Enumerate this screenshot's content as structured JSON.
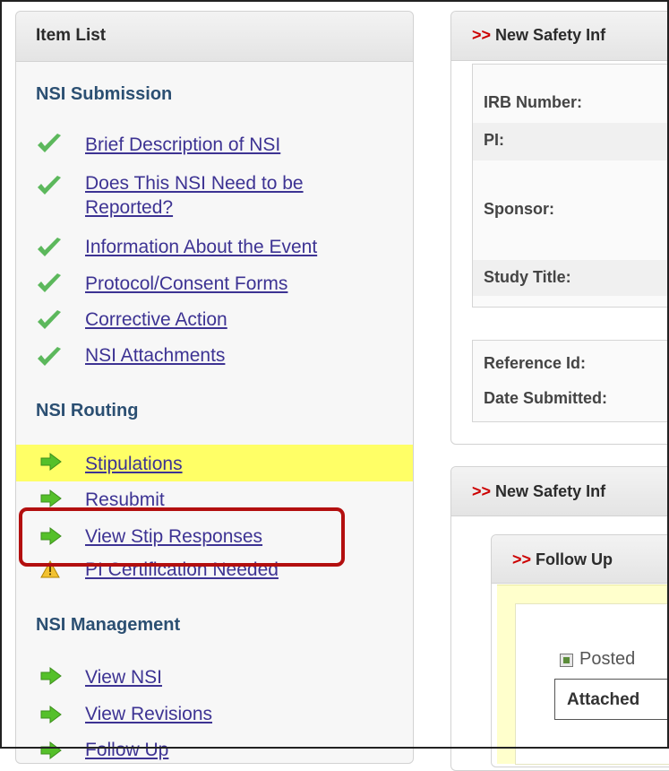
{
  "item_list": {
    "title": "Item List",
    "sections": [
      {
        "title": "NSI Submission",
        "items": [
          {
            "label": "Brief Description of NSI",
            "icon": "check-icon"
          },
          {
            "label": "Does This NSI Need to be Reported?",
            "icon": "check-icon"
          },
          {
            "label": "Information About the Event",
            "icon": "check-icon"
          },
          {
            "label": "Protocol/Consent Forms",
            "icon": "check-icon"
          },
          {
            "label": "Corrective Action",
            "icon": "check-icon"
          },
          {
            "label": "NSI Attachments",
            "icon": "check-icon"
          }
        ]
      },
      {
        "title": "NSI Routing",
        "items": [
          {
            "label": "Stipulations",
            "icon": "arrow-right-icon",
            "highlighted": true
          },
          {
            "label": "Resubmit",
            "icon": "arrow-right-icon"
          },
          {
            "label": "View Stip Responses",
            "icon": "arrow-right-icon",
            "callout": true
          },
          {
            "label": "PI Certification Needed",
            "icon": "warning-icon"
          }
        ]
      },
      {
        "title": "NSI Management",
        "items": [
          {
            "label": "View NSI",
            "icon": "arrow-right-icon"
          },
          {
            "label": "View Revisions",
            "icon": "arrow-right-icon"
          },
          {
            "label": "Follow Up",
            "icon": "arrow-right-icon"
          }
        ]
      }
    ]
  },
  "info_panel": {
    "prefix": ">>",
    "title": "New Safety Inf",
    "fields": [
      "IRB Number:",
      "PI:",
      "Sponsor:",
      "Study Title:"
    ],
    "ref_fields": [
      "Reference Id:",
      "Date Submitted:"
    ]
  },
  "second_panel": {
    "prefix": ">>",
    "title": "New Safety Inf",
    "follow_up": {
      "prefix": ">>",
      "title": "Follow Up",
      "posted_label": "Posted",
      "attached_label": "Attached"
    }
  },
  "colors": {
    "link": "#3d3393",
    "section_heading": "#2b4f72",
    "highlight": "#ffff66",
    "callout_border": "#b30f0f",
    "check_green": "#5cb85c",
    "arrow_green": "#55c02a",
    "panel_prefix_red": "#cc0000"
  }
}
